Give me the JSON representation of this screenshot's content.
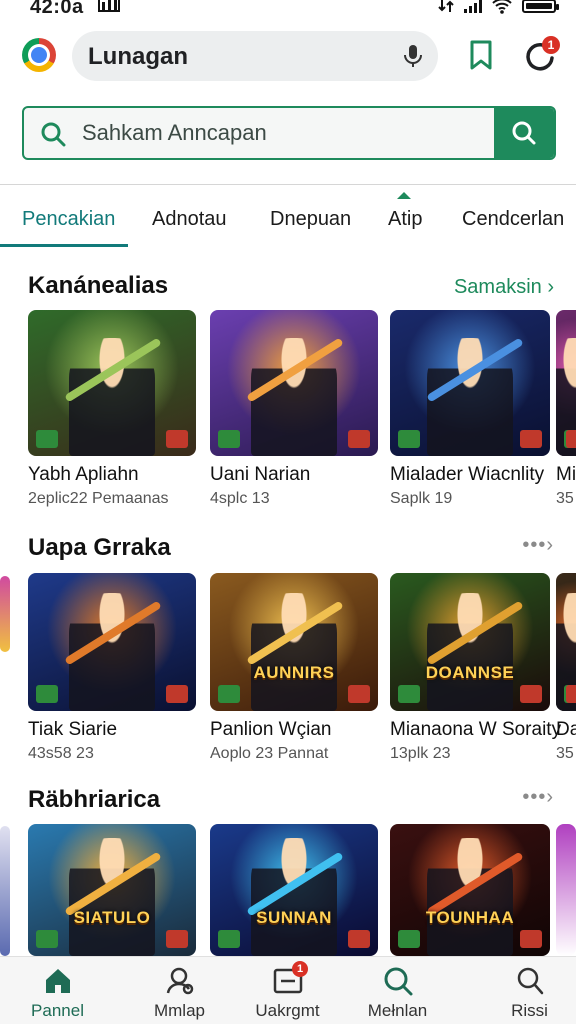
{
  "status_bar": {
    "time": "42:0a"
  },
  "browser": {
    "omnibox_text": "Lunagan",
    "notification_count": "1"
  },
  "search": {
    "placeholder": "Sahkam Anncapan"
  },
  "tabs": [
    {
      "label": "Pencakian",
      "active": true
    },
    {
      "label": "Adnotau",
      "active": false
    },
    {
      "label": "Dnepuan",
      "active": false
    },
    {
      "label": "Atip",
      "active": false
    },
    {
      "label": "Cendcerlan",
      "active": false
    }
  ],
  "sections": [
    {
      "title": "Kanánealias",
      "link": "Samaksin ›",
      "cards": [
        {
          "name": "Yabh Apliahn",
          "sub": "2eplic22 Pemaanas",
          "logo": "",
          "palette": [
            "#2f6b2a",
            "#9bc55a",
            "#3a2a1a"
          ]
        },
        {
          "name": "Uani Narian",
          "sub": "4splc 13",
          "logo": "",
          "palette": [
            "#6b3fb0",
            "#f0a040",
            "#2a1a50"
          ]
        },
        {
          "name": "Mialader Wiacnlity",
          "sub": "Saplk 19",
          "logo": "",
          "palette": [
            "#1a2a6b",
            "#4a90e0",
            "#0a1030"
          ]
        },
        {
          "name": "Mi",
          "sub": "35",
          "logo": "",
          "palette": [
            "#6b2a6b",
            "#e05ab0",
            "#200a20"
          ]
        }
      ]
    },
    {
      "title": "Uapa Grraka",
      "more": "•••›",
      "cards": [
        {
          "name": "Tiak Siarie",
          "sub": "43s58 23",
          "logo": "",
          "palette": [
            "#1f3a8a",
            "#e07a2a",
            "#0a1030"
          ]
        },
        {
          "name": "Panlion Wçian",
          "sub": "Aoplo 23 Pannat",
          "logo": "AUNNIRS",
          "palette": [
            "#8a5a1f",
            "#f0c050",
            "#3a1a0a"
          ]
        },
        {
          "name": "Mianaona W Soraity",
          "sub": "13plk 23",
          "logo": "DOANNSE",
          "palette": [
            "#2a5a1f",
            "#e0a030",
            "#1a0a0a"
          ]
        },
        {
          "name": "Da",
          "sub": "35",
          "logo": "",
          "palette": [
            "#3a2a1a",
            "#e06a2a",
            "#100a05"
          ]
        }
      ]
    },
    {
      "title": "Räbhriarica",
      "more": "•••›",
      "cards": [
        {
          "name": "",
          "sub": "",
          "logo": "SIATULO",
          "palette": [
            "#2a7ab0",
            "#f0b040",
            "#1a2a3a"
          ]
        },
        {
          "name": "",
          "sub": "",
          "logo": "SUNNAN",
          "palette": [
            "#1a3a8a",
            "#40c0f0",
            "#0a0a30"
          ]
        },
        {
          "name": "",
          "sub": "",
          "logo": "TOUNHAA",
          "palette": [
            "#3a1010",
            "#e05a2a",
            "#100505"
          ]
        }
      ]
    }
  ],
  "bottom_nav": [
    {
      "label": "Pannel",
      "icon": "home-icon",
      "active": true
    },
    {
      "label": "Mmlap",
      "icon": "person-chat-icon",
      "active": false
    },
    {
      "label": "Uakrgmt",
      "icon": "inbox-icon",
      "active": false,
      "badge": "1"
    },
    {
      "label": "Mełnlan",
      "icon": "search-icon",
      "active": false
    },
    {
      "label": "Rissi",
      "icon": "profile-search-icon",
      "active": false
    }
  ],
  "colors": {
    "accent": "#1e8a5c",
    "tab_active": "#127a7a",
    "badge": "#d93025"
  }
}
